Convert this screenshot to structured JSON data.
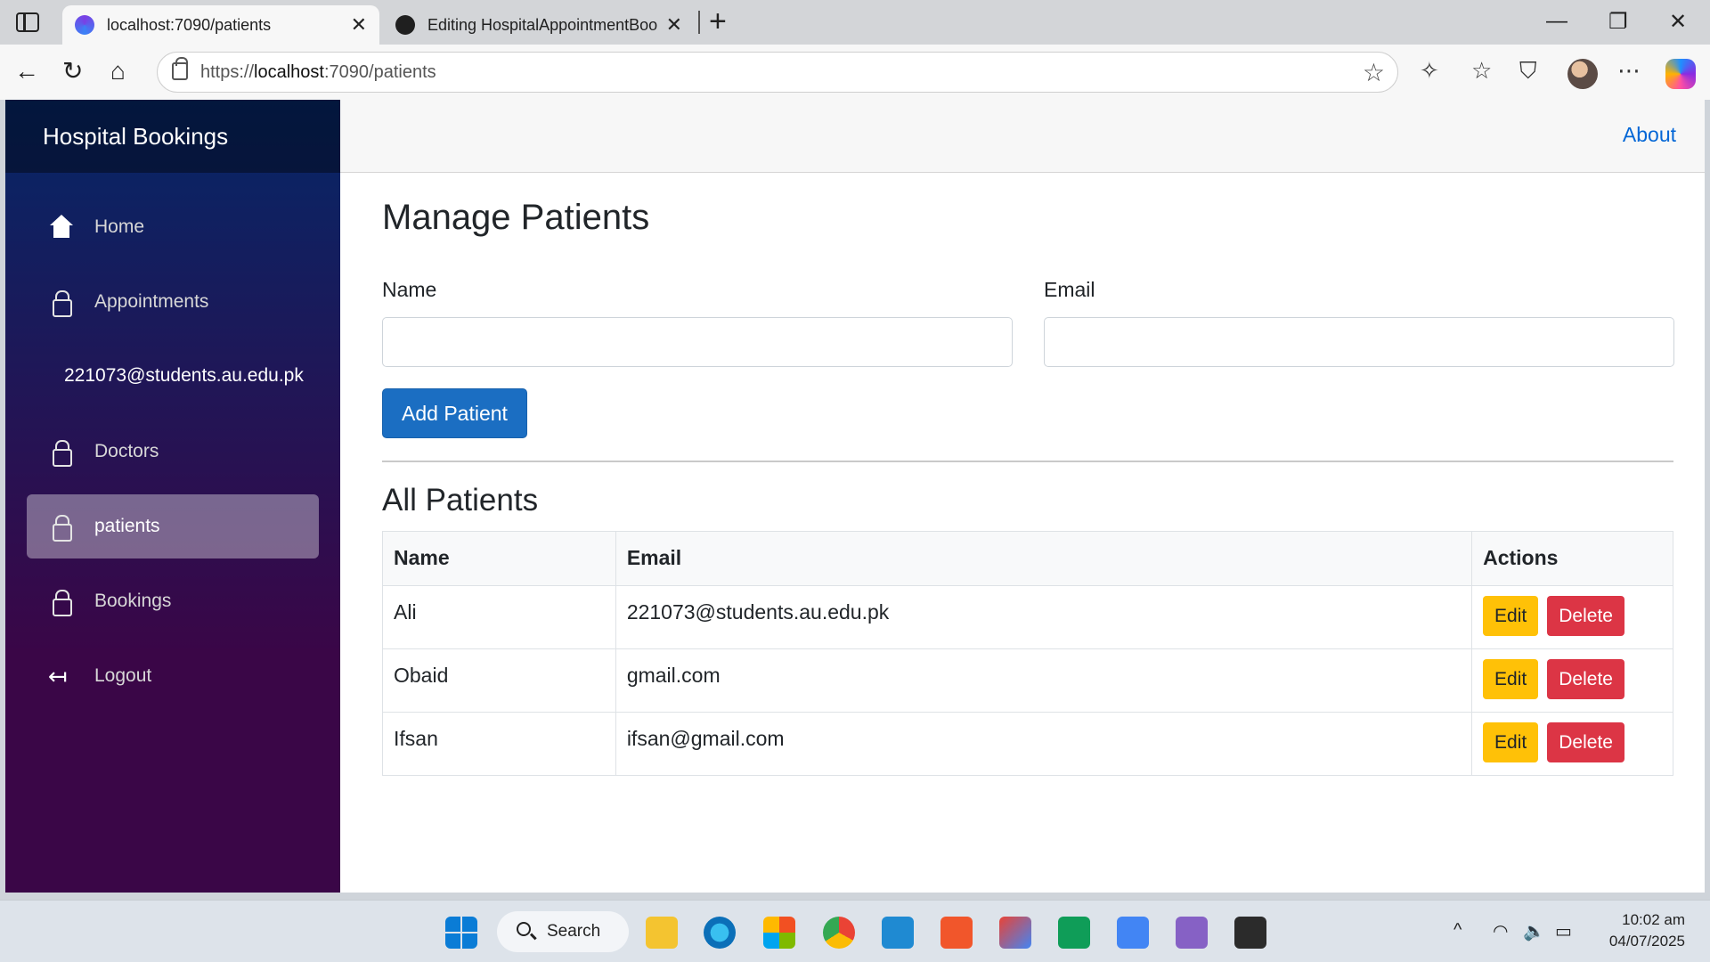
{
  "browser": {
    "tabs": [
      {
        "title": "localhost:7090/patients",
        "active": true
      },
      {
        "title": "Editing HospitalAppointmentBool",
        "active": false
      }
    ],
    "url_scheme": "https://",
    "url_host": "localhost",
    "url_rest": ":7090/patients"
  },
  "app": {
    "brand": "Hospital Bookings",
    "about_link": "About",
    "sidebar": {
      "items": [
        {
          "label": "Home",
          "icon": "home-icon"
        },
        {
          "label": "Appointments",
          "icon": "lock-icon"
        },
        {
          "label": "Doctors",
          "icon": "lock-icon"
        },
        {
          "label": "patients",
          "icon": "lock-icon",
          "active": true
        },
        {
          "label": "Bookings",
          "icon": "lock-icon"
        },
        {
          "label": "Logout",
          "icon": "logout-icon"
        }
      ],
      "user_email": "221073@students.au.edu.pk"
    }
  },
  "main": {
    "title": "Manage Patients",
    "form": {
      "name_label": "Name",
      "name_value": "",
      "email_label": "Email",
      "email_value": "",
      "submit_label": "Add Patient"
    },
    "list_title": "All Patients",
    "table": {
      "headers": [
        "Name",
        "Email",
        "Actions"
      ],
      "rows": [
        {
          "name": "Ali",
          "email": "221073@students.au.edu.pk"
        },
        {
          "name": "Obaid",
          "email": "gmail.com"
        },
        {
          "name": "Ifsan",
          "email": "ifsan@gmail.com"
        }
      ],
      "edit_label": "Edit",
      "delete_label": "Delete"
    }
  },
  "taskbar": {
    "search_label": "Search",
    "time": "10:02 am",
    "date": "04/07/2025"
  },
  "colors": {
    "primary_button": "#1b6ec2",
    "edit_button": "#ffc107",
    "delete_button": "#dc3545",
    "link": "#0366d6"
  }
}
